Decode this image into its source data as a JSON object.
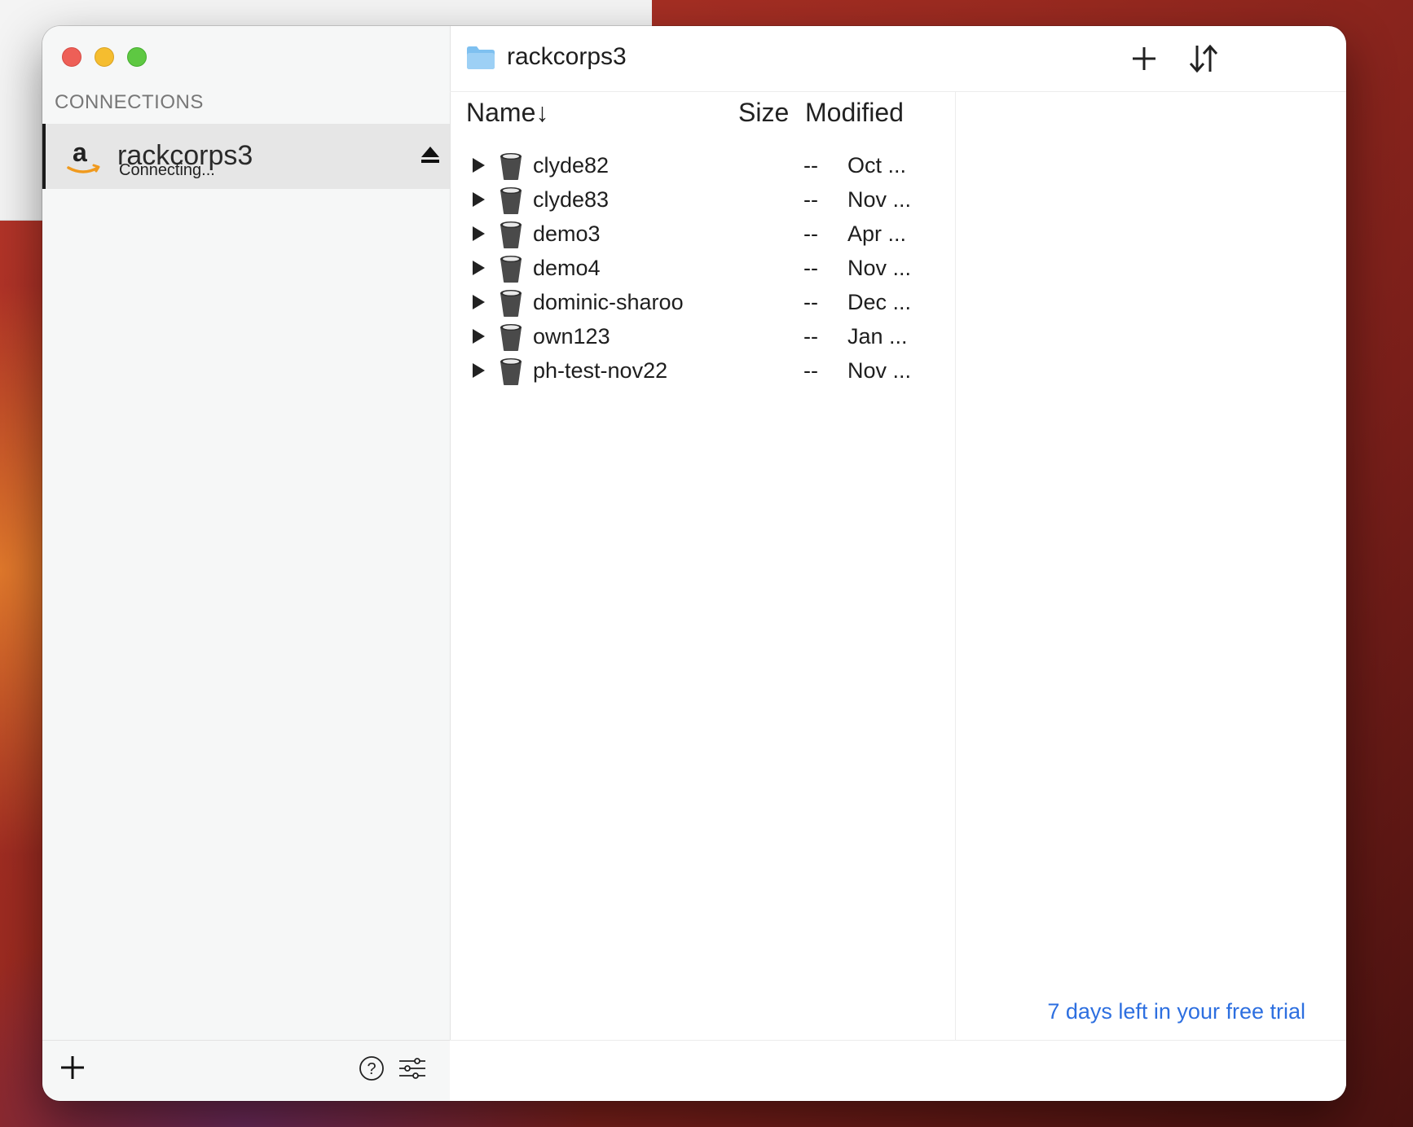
{
  "sidebar": {
    "section_title": "CONNECTIONS",
    "connections": [
      {
        "name": "rackcorps3",
        "status": "Connecting...",
        "icon": "amazon-logo-icon"
      }
    ]
  },
  "toolbar": {
    "title": "rackcorps3",
    "icons": [
      "folder-icon",
      "add-icon",
      "sort-icon"
    ]
  },
  "file_list": {
    "columns": {
      "name": "Name↓",
      "size": "Size",
      "modified": "Modified"
    },
    "rows": [
      {
        "name": "clyde82",
        "size": "--",
        "modified": "Oct ..."
      },
      {
        "name": "clyde83",
        "size": "--",
        "modified": "Nov ..."
      },
      {
        "name": "demo3",
        "size": "--",
        "modified": "Apr ..."
      },
      {
        "name": "demo4",
        "size": "--",
        "modified": "Nov ..."
      },
      {
        "name": "dominic-sharoo",
        "size": "--",
        "modified": "Dec ..."
      },
      {
        "name": "own123",
        "size": "--",
        "modified": "Jan ..."
      },
      {
        "name": "ph-test-nov22",
        "size": "--",
        "modified": "Nov ..."
      }
    ]
  },
  "trial": {
    "text": "7 days left in your free trial"
  },
  "colors": {
    "link": "#2d6fe0",
    "selection": "#e6e6e6",
    "folder": "#7ec0f0"
  }
}
